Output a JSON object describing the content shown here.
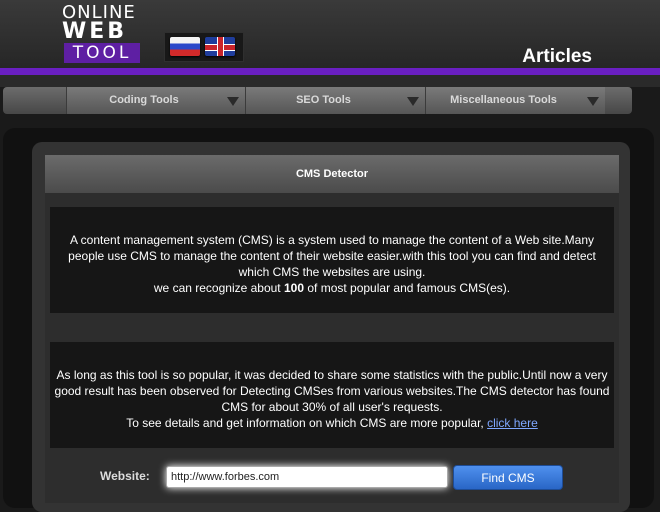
{
  "logo": {
    "line1": "ONLINE",
    "line2": "WEB",
    "line3": "TOOL"
  },
  "flags": [
    {
      "name": "russian-flag"
    },
    {
      "name": "english-flag"
    }
  ],
  "header": {
    "right_link": "Articles"
  },
  "colors": {
    "accent": "#6a1fc2",
    "button": "#3a7be0",
    "link": "#7fa7ff"
  },
  "nav": {
    "items": [
      {
        "label": "Coding Tools"
      },
      {
        "label": "SEO Tools"
      },
      {
        "label": "Miscellaneous Tools"
      }
    ]
  },
  "panel": {
    "title": "CMS Detector",
    "intro": {
      "line1": "A content management system (CMS) is a system used to manage the content of a Web site.Many",
      "line2": "people use CMS to manage the content of their website easier.with this tool you can find and detect",
      "line3": "which CMS the websites are using.",
      "line4_pre": "we can recognize about ",
      "line4_bold": "100",
      "line4_post": " of most popular and famous CMS(es)."
    },
    "stats": {
      "line1": "As long as this tool is so popular, it was decided to share some statistics with the public.Until now a very",
      "line2": "good result has been observed for Detecting CMSes from various websites.The CMS detector has found",
      "line3": "CMS for about 30% of all user's requests.",
      "line4_pre": "To see details and get information on which CMS are more popular, ",
      "link": "click here"
    }
  },
  "form": {
    "website_label": "Website:",
    "website_value": "http://www.forbes.com",
    "submit_label": "Find CMS"
  }
}
